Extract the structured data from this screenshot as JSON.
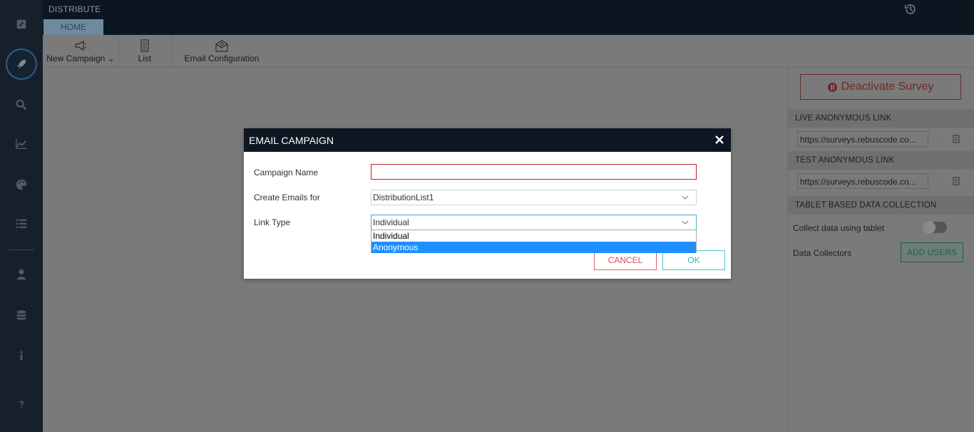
{
  "app": {
    "title": "DISTRIBUTE",
    "tab_home": "HOME"
  },
  "ribbon": {
    "new_campaign": "New Campaign",
    "list": "List",
    "email_configuration": "Email Configuration"
  },
  "sidebar": {
    "icons": [
      "pencil-icon",
      "rocket-icon",
      "search-icon",
      "chart-icon",
      "palette-icon",
      "list-icon",
      "user-icon",
      "database-icon",
      "info-icon",
      "help-icon"
    ]
  },
  "right_panel": {
    "deactivate_label": "Deactivate Survey",
    "live_link_header": "LIVE ANONYMOUS LINK",
    "live_link_value": "https://surveys.rebuscode.co...",
    "test_link_header": "TEST ANONYMOUS LINK",
    "test_link_value": "https://surveys.rebuscode.co...",
    "tablet_header": "TABLET BASED DATA COLLECTION",
    "collect_label": "Collect data using tablet",
    "collectors_label": "Data Collectors",
    "add_users_label": "ADD USERS"
  },
  "modal": {
    "title": "EMAIL CAMPAIGN",
    "campaign_name_label": "Campaign Name",
    "campaign_name_value": "",
    "create_emails_label": "Create Emails for",
    "create_emails_value": "DistributionList1",
    "link_type_label": "Link Type",
    "link_type_value": "Individual",
    "link_type_options": [
      "Individual",
      "Anonymous"
    ],
    "highlighted_option": "Anonymous",
    "cancel_label": "CANCEL",
    "ok_label": "OK"
  }
}
